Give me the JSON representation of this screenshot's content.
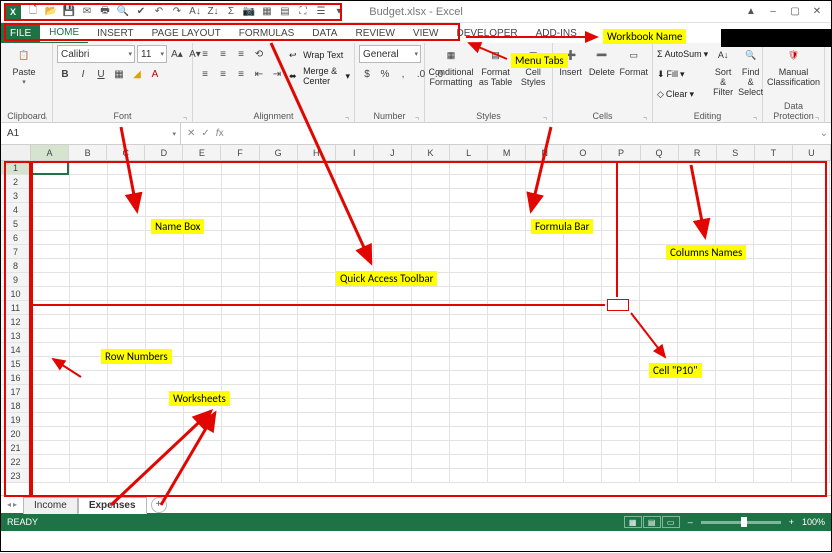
{
  "title": "Budget.xlsx - Excel",
  "qat_icons": [
    "new",
    "open",
    "save",
    "mail",
    "quickprint",
    "preview",
    "spell",
    "undo",
    "redo",
    "sortasc",
    "sortdesc",
    "pivot",
    "sum",
    "camera",
    "table",
    "macro",
    "fullscreen",
    "touch",
    "more"
  ],
  "tabs": {
    "items": [
      "FILE",
      "HOME",
      "INSERT",
      "PAGE LAYOUT",
      "FORMULAS",
      "DATA",
      "REVIEW",
      "VIEW",
      "DEVELOPER",
      "ADD-INS"
    ],
    "active": "HOME"
  },
  "ribbon": {
    "clipboard": {
      "label": "Clipboard",
      "paste": "Paste"
    },
    "font": {
      "label": "Font",
      "name": "Calibri",
      "size": "11"
    },
    "alignment": {
      "label": "Alignment",
      "wrap": "Wrap Text",
      "merge": "Merge & Center"
    },
    "number": {
      "label": "Number",
      "format": "General"
    },
    "styles": {
      "label": "Styles",
      "cf": "Conditional Formatting",
      "fat": "Format as Table",
      "cs": "Cell Styles"
    },
    "cells": {
      "label": "Cells",
      "insert": "Insert",
      "delete": "Delete",
      "format": "Format"
    },
    "editing": {
      "label": "Editing",
      "autosum": "AutoSum",
      "fill": "Fill",
      "clear": "Clear",
      "sort": "Sort & Filter",
      "find": "Find & Select"
    },
    "dp": {
      "label": "Data Protection",
      "manual": "Manual Classification"
    }
  },
  "name_box": "A1",
  "columns": [
    "A",
    "B",
    "C",
    "D",
    "E",
    "F",
    "G",
    "H",
    "I",
    "J",
    "K",
    "L",
    "M",
    "N",
    "O",
    "P",
    "Q",
    "R",
    "S",
    "T",
    "U"
  ],
  "row_count": 23,
  "sheets": {
    "items": [
      "Income",
      "Expenses"
    ],
    "active": "Expenses"
  },
  "status": {
    "ready": "READY",
    "zoom": "100%"
  },
  "annotations": {
    "workbook_name": "Workbook Name",
    "menu_tabs": "Menu Tabs",
    "name_box": "Name Box",
    "formula_bar": "Formula Bar",
    "columns_names": "Columns Names",
    "qat": "Quick Access Toolbar",
    "row_numbers": "Row Numbers",
    "worksheets": "Worksheets",
    "cell_p10": "Cell \"P10\""
  }
}
